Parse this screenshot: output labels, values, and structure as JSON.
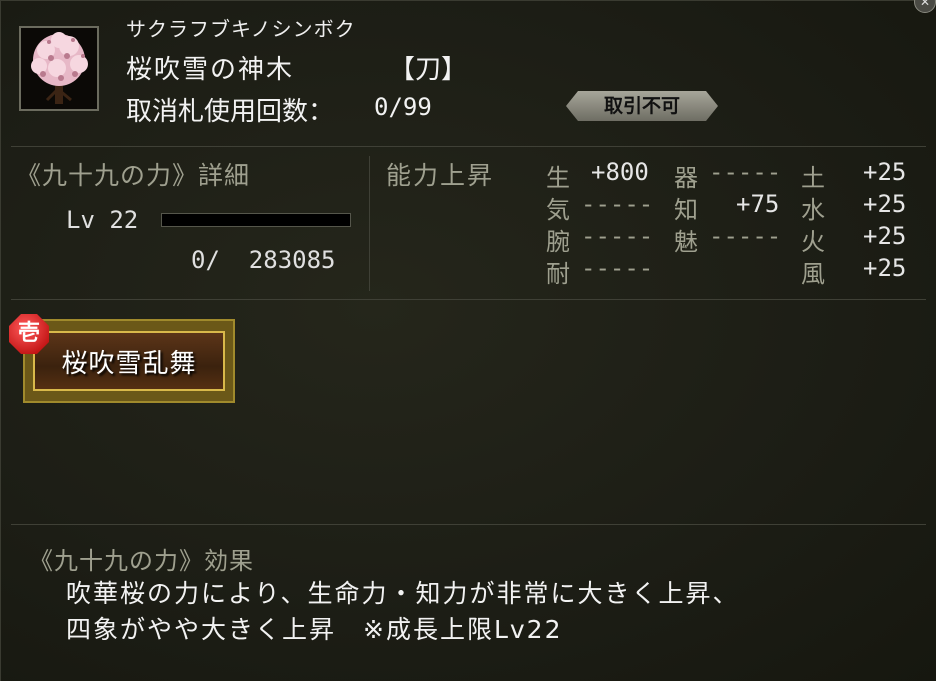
{
  "item": {
    "furigana": "サクラフブキノシンボク",
    "name": "桜吹雪の神木",
    "type": "【刀】",
    "usage_label": "取消札使用回数：",
    "usage_value": "0/99",
    "trade_badge": "取引不可",
    "icon": "cherry-blossom-tree-icon"
  },
  "power": {
    "title": "《九十九の力》詳細",
    "level_text": "Lv 22",
    "exp_progress": 0.0,
    "exp_text": "0/  283085"
  },
  "ability": {
    "title": "能力上昇",
    "col1": [
      {
        "label": "生",
        "value": "+800"
      },
      {
        "label": "気",
        "value": "-----"
      },
      {
        "label": "腕",
        "value": "-----"
      },
      {
        "label": "耐",
        "value": "-----"
      }
    ],
    "col2": [
      {
        "label": "器",
        "value": "-----"
      },
      {
        "label": "知",
        "value": "+75"
      },
      {
        "label": "魅",
        "value": "-----"
      }
    ],
    "col3": [
      {
        "label": "土",
        "value": "+25"
      },
      {
        "label": "水",
        "value": "+25"
      },
      {
        "label": "火",
        "value": "+25"
      },
      {
        "label": "風",
        "value": "+25"
      }
    ]
  },
  "skill": {
    "rank": "壱",
    "name": "桜吹雪乱舞"
  },
  "effect": {
    "title": "《九十九の力》効果",
    "line1": "吹華桜の力により、生命力・知力が非常に大きく上昇、",
    "line2": "四象がやや大きく上昇　※成長上限Lv22"
  }
}
